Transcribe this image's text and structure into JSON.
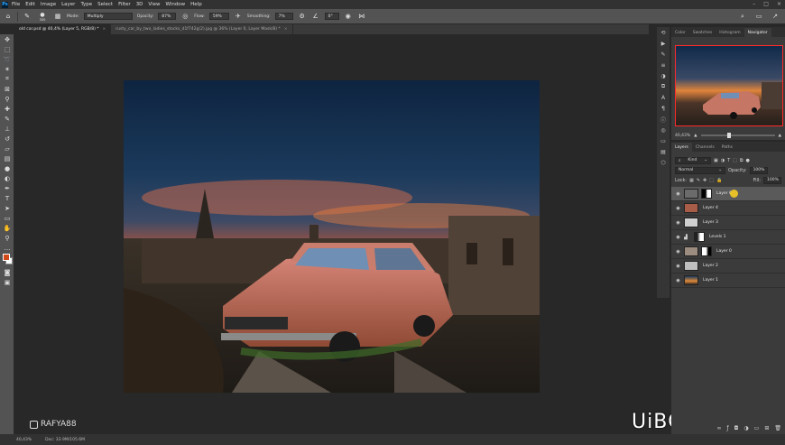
{
  "menubar": {
    "logo": "Ps",
    "items": [
      "File",
      "Edit",
      "Image",
      "Layer",
      "Type",
      "Select",
      "Filter",
      "3D",
      "View",
      "Window",
      "Help"
    ]
  },
  "options": {
    "brush_size": "300",
    "mode_label": "Mode:",
    "mode_value": "Multiply",
    "opacity_label": "Opacity:",
    "opacity_value": "87%",
    "flow_label": "Flow:",
    "flow_value": "59%",
    "smoothing_label": "Smoothing:",
    "smoothing_value": "7%",
    "angle_value": "0°"
  },
  "tabs": [
    {
      "label": "old car.psd @ 40,4% (Layer 5, RGB/8) *",
      "close": "×"
    },
    {
      "label": "rusty_car_by_two_ladies_stocks_d1f742g(2).jpg @ 36% (Layer 0, Layer Mask/8) *",
      "close": "×"
    }
  ],
  "watermarks": {
    "left": "RAFYA88",
    "right": "UiBQ.CoM"
  },
  "status": {
    "zoom": "40,43%",
    "doc": "Doc: 33.9M/105.6M"
  },
  "nav_tabs": [
    "Color",
    "Swatches",
    "Histogram",
    "Navigator"
  ],
  "nav_zoom": "40,43%",
  "layers_tabs": [
    "Layers",
    "Channels",
    "Paths"
  ],
  "layers_ctl": {
    "kind": "Kind",
    "blend": "Normal",
    "opacity_label": "Opacity:",
    "opacity_value": "100%",
    "lock_label": "Lock:",
    "fill_label": "Fill:",
    "fill_value": "100%"
  },
  "layers": [
    {
      "name": "Layer 6",
      "selected": true,
      "mask": true
    },
    {
      "name": "Layer 4",
      "selected": false,
      "mask": false
    },
    {
      "name": "Layer 3",
      "selected": false,
      "mask": false
    },
    {
      "name": "Levels 1",
      "selected": false,
      "mask": true
    },
    {
      "name": "Layer 0",
      "selected": false,
      "mask": true
    },
    {
      "name": "Layer 2",
      "selected": false,
      "mask": false
    },
    {
      "name": "Layer 1",
      "selected": false,
      "mask": false
    }
  ],
  "icons": {
    "close": "×",
    "minimize": "–",
    "maximize": "□",
    "eye": "👁",
    "search": "⌕"
  },
  "colors": {
    "accent": "#31a8ff",
    "foreground": "#d24a1a",
    "background": "#ffffff"
  }
}
